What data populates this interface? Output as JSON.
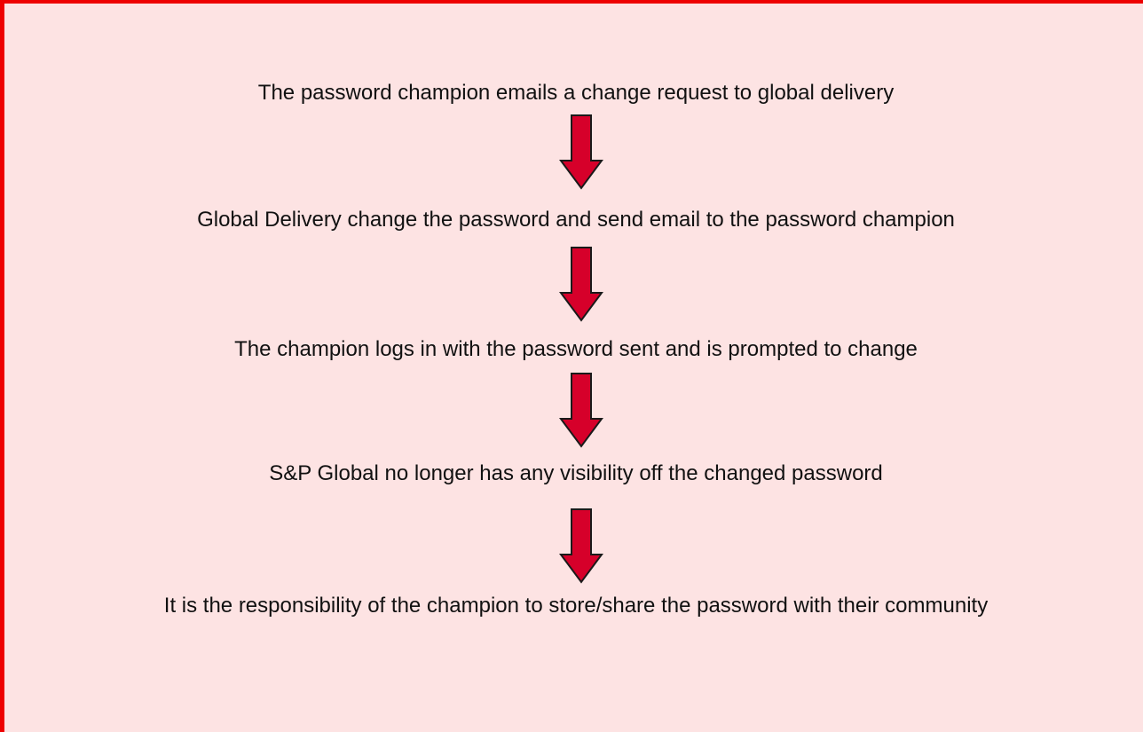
{
  "flow": {
    "steps": [
      "The password champion emails a change request to global delivery",
      "Global Delivery change the password and send email to the password champion",
      "The champion logs in with the password sent and is prompted to change",
      "S&P Global no longer has any visibility off the changed password",
      "It is the responsibility of the champion to store/share the password with their community"
    ],
    "colors": {
      "border": "#ee0000",
      "background": "#fde3e3",
      "arrow_fill": "#d6002a",
      "arrow_stroke": "#1a1a1a"
    }
  }
}
